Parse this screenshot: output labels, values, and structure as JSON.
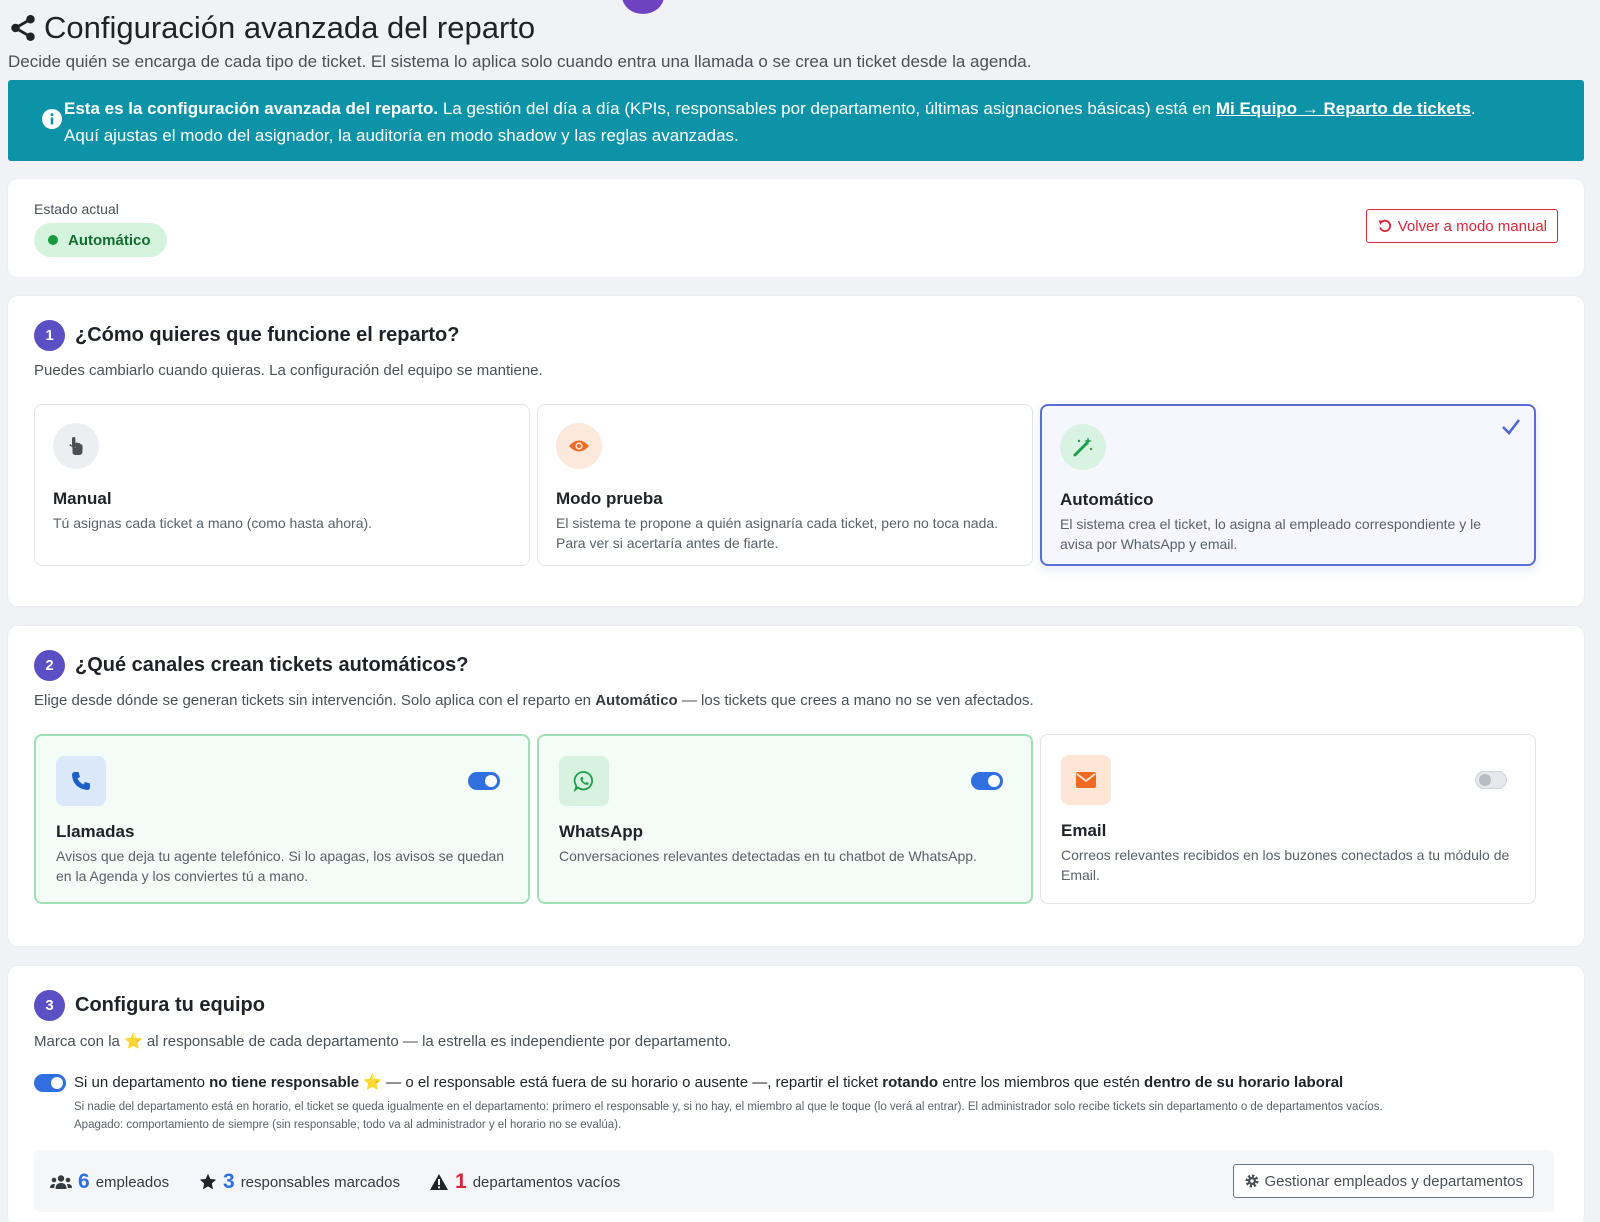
{
  "header": {
    "title": "Configuración avanzada del reparto",
    "subtitle": "Decide quién se encarga de cada tipo de ticket. El sistema lo aplica solo cuando entra una llamada o se crea un ticket desde la agenda."
  },
  "alert": {
    "bold": "Esta es la configuración avanzada del reparto.",
    "text1": " La gestión del día a día (KPIs, responsables por departamento, últimas asignaciones básicas) está en ",
    "link": "Mi Equipo → Reparto de tickets",
    "text2": ".",
    "line2": "Aquí ajustas el modo del asignador, la auditoría en modo shadow y las reglas avanzadas."
  },
  "status": {
    "label": "Estado actual",
    "value": "Automático",
    "revert_button": "Volver a modo manual"
  },
  "section1": {
    "step": "1",
    "title": "¿Cómo quieres que funcione el reparto?",
    "description": "Puedes cambiarlo cuando quieras. La configuración del equipo se mantiene.",
    "options": [
      {
        "title": "Manual",
        "description": "Tú asignas cada ticket a mano (como hasta ahora).",
        "icon": "hand-pointer-icon",
        "selected": false
      },
      {
        "title": "Modo prueba",
        "description": "El sistema te propone a quién asignaría cada ticket, pero no toca nada. Para ver si acertaría antes de fiarte.",
        "icon": "eye-icon",
        "selected": false
      },
      {
        "title": "Automático",
        "description": "El sistema crea el ticket, lo asigna al empleado correspondiente y le avisa por WhatsApp y email.",
        "icon": "magic-wand-icon",
        "selected": true
      }
    ]
  },
  "section2": {
    "step": "2",
    "title": "¿Qué canales crean tickets automáticos?",
    "description_pre": "Elige desde dónde se generan tickets sin intervención. Solo aplica con el reparto en ",
    "description_bold": "Automático",
    "description_post": " — los tickets que crees a mano no se ven afectados.",
    "channels": [
      {
        "title": "Llamadas",
        "description": "Avisos que deja tu agente telefónico. Si lo apagas, los avisos se quedan en la Agenda y los conviertes tú a mano.",
        "enabled": true,
        "icon": "phone-icon"
      },
      {
        "title": "WhatsApp",
        "description": "Conversaciones relevantes detectadas en tu chatbot de WhatsApp.",
        "enabled": true,
        "icon": "whatsapp-icon"
      },
      {
        "title": "Email",
        "description": "Correos relevantes recibidos en los buzones conectados a tu módulo de Email.",
        "enabled": false,
        "icon": "envelope-icon"
      }
    ]
  },
  "section3": {
    "step": "3",
    "title": "Configura tu equipo",
    "desc_pre": "Marca con la ",
    "star": "⭐",
    "desc_post": " al responsable de cada departamento — la estrella es independiente por departamento.",
    "rule": {
      "enabled": true,
      "p1": "Si un departamento ",
      "p2": "no tiene responsable",
      "p3": " ⭐ — o el responsable está fuera de su horario o ausente —, repartir el ticket ",
      "p4": "rotando",
      "p5": " entre los miembros que estén ",
      "p6": "dentro de su horario laboral",
      "help1": "Si nadie del departamento está en horario, el ticket se queda igualmente en el departamento: primero el responsable y, si no hay, el miembro al que le toque (lo verá al entrar). El administrador solo recibe tickets sin departamento o de departamentos vacíos.",
      "help2": "Apagado: comportamiento de siempre (sin responsable, todo va al administrador y el horario no se evalúa)."
    },
    "stats": {
      "employees_count": "6",
      "employees_label": "empleados",
      "managers_count": "3",
      "managers_label": "responsables marcados",
      "empty_count": "1",
      "empty_label": "departamentos vacíos"
    },
    "manage_button": "Gestionar empleados y departamentos"
  },
  "colors": {
    "accent": "#5b4fc4",
    "alert_bg": "#0c93a8",
    "success": "#1a9a3e",
    "danger": "#d9263a",
    "toggle_on": "#2f6fe0"
  }
}
